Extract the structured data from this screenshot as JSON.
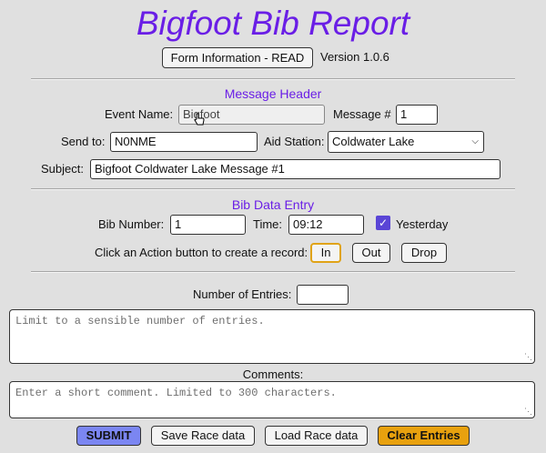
{
  "header": {
    "title": "Bigfoot Bib Report",
    "form_info_label": "Form Information - READ",
    "version": "Version 1.0.6"
  },
  "message_header": {
    "section_title": "Message Header",
    "event_name_label": "Event Name:",
    "event_name_value": "Bigfoot",
    "message_num_label": "Message #",
    "message_num_value": "1",
    "send_to_label": "Send to:",
    "send_to_value": "N0NME",
    "aid_station_label": "Aid Station:",
    "aid_station_value": "Coldwater Lake",
    "subject_label": "Subject:",
    "subject_value": "Bigfoot Coldwater Lake Message #1"
  },
  "bib_entry": {
    "section_title": "Bib Data Entry",
    "bib_number_label": "Bib Number:",
    "bib_number_value": "1",
    "time_label": "Time:",
    "time_value": "09:12",
    "yesterday_label": "Yesterday",
    "yesterday_checked": true,
    "action_prompt": "Click an Action button to create a record:",
    "actions": [
      "In",
      "Out",
      "Drop"
    ]
  },
  "entries": {
    "count_label": "Number of Entries:",
    "count_value": "",
    "entries_placeholder": "Limit to a sensible number of entries.",
    "comments_label": "Comments:",
    "comments_placeholder": "Enter a short comment. Limited to 300 characters."
  },
  "footer": {
    "submit_label": "SUBMIT",
    "save_label": "Save Race data",
    "load_label": "Load Race data",
    "clear_label": "Clear Entries"
  },
  "colors": {
    "title": "#6a1ee6",
    "submit": "#7b86f2",
    "clear": "#e8a10e",
    "focus": "#e0a317",
    "checkbox": "#5a45d6"
  }
}
